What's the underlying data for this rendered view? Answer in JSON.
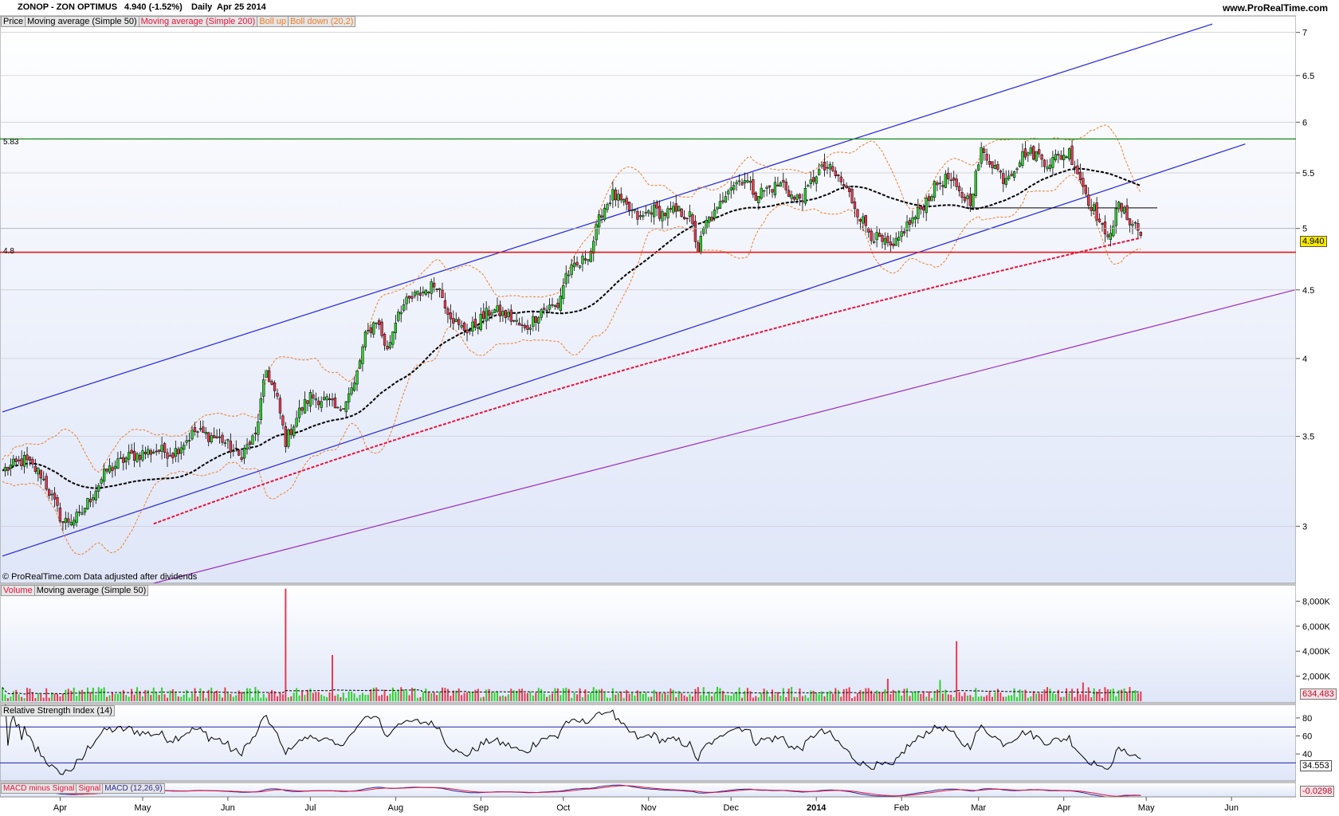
{
  "header": {
    "symbol": "ZONOP - ZON OPTIMUS",
    "quote": "4.940 (-1.52%)",
    "period": "Daily",
    "date": "Apr 25 2014",
    "brand": "www.ProRealTime.com"
  },
  "price_panel": {
    "legend": [
      {
        "text": "Price",
        "color": "#000000"
      },
      {
        "text": "Moving average (Simple 50)",
        "color": "#000000"
      },
      {
        "text": "Moving average (Simple 200)",
        "color": "#e8123c"
      },
      {
        "text": "Boll up",
        "color": "#f07d28"
      },
      {
        "text": "Boll down (20,2)",
        "color": "#f07d28"
      }
    ],
    "footer": "© ProRealTime.com  Data adjusted after dividends",
    "level_583": "5.83",
    "level_48": "4.8",
    "last_price": "4.940",
    "axis_ticks": [
      "7",
      "6.5",
      "6",
      "5.5",
      "5",
      "4.5",
      "4",
      "3.5",
      "3"
    ]
  },
  "volume_panel": {
    "legend": [
      {
        "text": "Volume",
        "color": "#e8123c"
      },
      {
        "text": "Moving average (Simple 50)",
        "color": "#000000"
      }
    ],
    "axis_ticks": [
      "8,000K",
      "6,000K",
      "4,000K",
      "2,000K"
    ],
    "last_value": "634,483"
  },
  "rsi_panel": {
    "legend": [
      {
        "text": "Relative Strength Index (14)",
        "color": "#000000"
      }
    ],
    "axis_ticks": [
      "80",
      "60",
      "40"
    ],
    "last_value": "34.553"
  },
  "macd_panel": {
    "legend": [
      {
        "text": "MACD minus Signal",
        "color": "#e8123c"
      },
      {
        "text": "Signal",
        "color": "#e8123c"
      },
      {
        "text": "MACD (12,26,9)",
        "color": "#2a2aa0"
      }
    ],
    "last_value": "-0.0298"
  },
  "x_axis": {
    "labels": [
      {
        "text": "Apr",
        "day": 21,
        "bold": false
      },
      {
        "text": "May",
        "day": 51,
        "bold": false
      },
      {
        "text": "Jun",
        "day": 82,
        "bold": false
      },
      {
        "text": "Jul",
        "day": 112,
        "bold": false
      },
      {
        "text": "Aug",
        "day": 143,
        "bold": false
      },
      {
        "text": "Sep",
        "day": 174,
        "bold": false
      },
      {
        "text": "Oct",
        "day": 204,
        "bold": false
      },
      {
        "text": "Nov",
        "day": 235,
        "bold": false
      },
      {
        "text": "Dec",
        "day": 265,
        "bold": false
      },
      {
        "text": "2014",
        "day": 296,
        "bold": true
      },
      {
        "text": "Feb",
        "day": 327,
        "bold": false
      },
      {
        "text": "Mar",
        "day": 355,
        "bold": false
      },
      {
        "text": "Apr",
        "day": 386,
        "bold": false
      },
      {
        "text": "May",
        "day": 416,
        "bold": false
      },
      {
        "text": "Jun",
        "day": 447,
        "bold": false
      }
    ]
  },
  "colors": {
    "up": "#30d030",
    "down": "#e83a50",
    "channel": "#2222e0",
    "support": "#e81818",
    "resistance": "#108a10",
    "trend_purple": "#9a2ac8",
    "ma200": "#e8123c",
    "ma50": "#000000",
    "boll": "#f07d28",
    "last_price_bg": "#f5e600"
  },
  "chart_data": {
    "type": "candlestick",
    "x_unit": "days since Mar 15 2013",
    "price_range": [
      2.72,
      7.2
    ],
    "log_scale": true,
    "anchors": [
      [
        0,
        3.3
      ],
      [
        8,
        3.36
      ],
      [
        14,
        3.28
      ],
      [
        22,
        3.02
      ],
      [
        28,
        3.05
      ],
      [
        38,
        3.3
      ],
      [
        46,
        3.38
      ],
      [
        56,
        3.42
      ],
      [
        62,
        3.4
      ],
      [
        70,
        3.53
      ],
      [
        80,
        3.48
      ],
      [
        86,
        3.38
      ],
      [
        92,
        3.5
      ],
      [
        96,
        3.92
      ],
      [
        100,
        3.72
      ],
      [
        103,
        3.47
      ],
      [
        108,
        3.65
      ],
      [
        112,
        3.75
      ],
      [
        118,
        3.72
      ],
      [
        122,
        3.65
      ],
      [
        128,
        3.82
      ],
      [
        132,
        4.15
      ],
      [
        136,
        4.28
      ],
      [
        140,
        4.05
      ],
      [
        144,
        4.35
      ],
      [
        150,
        4.45
      ],
      [
        154,
        4.5
      ],
      [
        158,
        4.55
      ],
      [
        162,
        4.35
      ],
      [
        166,
        4.22
      ],
      [
        170,
        4.2
      ],
      [
        174,
        4.28
      ],
      [
        178,
        4.35
      ],
      [
        184,
        4.3
      ],
      [
        190,
        4.2
      ],
      [
        196,
        4.35
      ],
      [
        202,
        4.38
      ],
      [
        205,
        4.62
      ],
      [
        210,
        4.7
      ],
      [
        214,
        4.82
      ],
      [
        218,
        5.15
      ],
      [
        222,
        5.3
      ],
      [
        226,
        5.2
      ],
      [
        232,
        5.08
      ],
      [
        236,
        5.17
      ],
      [
        240,
        5.13
      ],
      [
        246,
        5.15
      ],
      [
        250,
        5.1
      ],
      [
        253,
        4.82
      ],
      [
        256,
        5.05
      ],
      [
        260,
        5.15
      ],
      [
        264,
        5.38
      ],
      [
        270,
        5.45
      ],
      [
        274,
        5.3
      ],
      [
        278,
        5.35
      ],
      [
        284,
        5.4
      ],
      [
        288,
        5.25
      ],
      [
        292,
        5.3
      ],
      [
        296,
        5.5
      ],
      [
        300,
        5.55
      ],
      [
        304,
        5.45
      ],
      [
        308,
        5.3
      ],
      [
        312,
        5.1
      ],
      [
        316,
        4.95
      ],
      [
        320,
        4.88
      ],
      [
        324,
        4.82
      ],
      [
        328,
        5.0
      ],
      [
        332,
        5.1
      ],
      [
        336,
        5.25
      ],
      [
        340,
        5.4
      ],
      [
        344,
        5.45
      ],
      [
        348,
        5.3
      ],
      [
        352,
        5.25
      ],
      [
        356,
        5.7
      ],
      [
        360,
        5.6
      ],
      [
        364,
        5.45
      ],
      [
        368,
        5.55
      ],
      [
        372,
        5.7
      ],
      [
        376,
        5.68
      ],
      [
        380,
        5.6
      ],
      [
        384,
        5.65
      ],
      [
        388,
        5.7
      ],
      [
        392,
        5.45
      ],
      [
        395,
        5.25
      ],
      [
        398,
        5.12
      ],
      [
        401,
        4.92
      ],
      [
        404,
        5.05
      ],
      [
        406,
        5.2
      ],
      [
        409,
        5.1
      ],
      [
        412,
        5.03
      ],
      [
        414,
        4.94
      ]
    ],
    "volume_spikes": [
      {
        "day": 103,
        "value": 9000
      },
      {
        "day": 120,
        "value": 3700
      },
      {
        "day": 347,
        "value": 4800
      },
      {
        "day": 322,
        "value": 1800
      },
      {
        "day": 341,
        "value": 1700
      },
      {
        "day": 393,
        "value": 1500
      }
    ],
    "volume_axis_max": 9300,
    "rsi_range": [
      10,
      95
    ],
    "rsi_last": 34.553,
    "macd_last": -0.0298,
    "support": 4.8,
    "resistance": 5.83,
    "last_close": 4.94
  }
}
